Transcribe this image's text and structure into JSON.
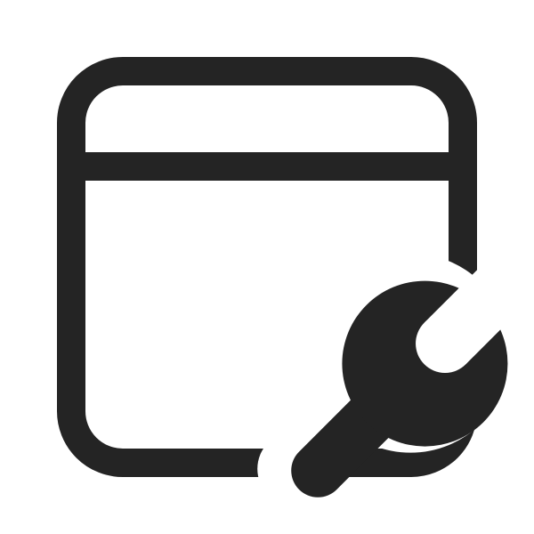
{
  "icon": {
    "name": "app-window-wrench-icon",
    "parts": [
      "window-frame-icon",
      "wrench-icon"
    ],
    "colors": {
      "stroke": "#242424",
      "fill": "#242424",
      "background": "#ffffff"
    }
  }
}
